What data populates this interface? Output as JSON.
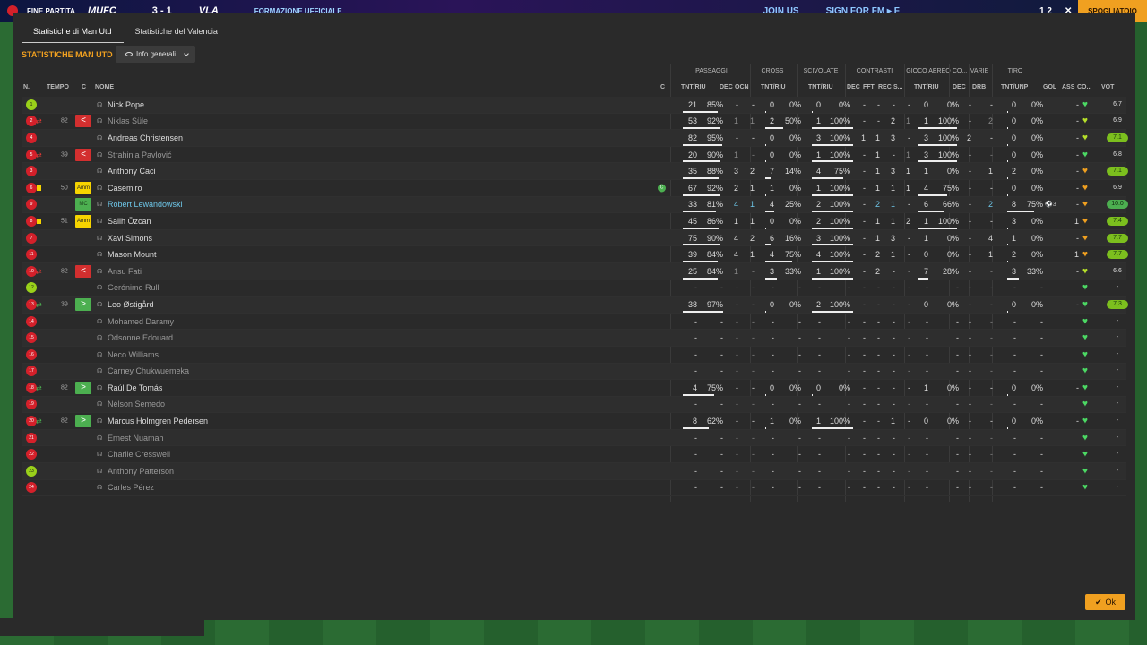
{
  "topbar": {
    "end_label": "FINE PARTITA",
    "home_team": "MUFC",
    "score": "3 - 1",
    "away_team": "VLA",
    "ad1": "FORMAZIONE UFFICIALE",
    "ad2": "JOIN US",
    "ad3": "SIGN FOR FM ▸ F",
    "page": "1 2",
    "close": "✕",
    "scout": "SPOGLIATOIO"
  },
  "tabs": [
    "Statistiche di Man Utd",
    "Statistiche del Valencia"
  ],
  "section_title": "STATISTICHE MAN UTD",
  "dropdown_label": "Info generali",
  "groups": [
    "PASSAGGI",
    "CROSS",
    "SCIVOLATE",
    "CONTRASTI",
    "GIOCO AEREO",
    "CO...",
    "VARIE",
    "TIRO"
  ],
  "headers": {
    "n": "N.",
    "tempo": "TEMPO",
    "c": "C",
    "nome": "NOME",
    "cap": "C",
    "pas_tnt": "TNT/RIU",
    "dec": "DEC",
    "ocn": "OCN",
    "cr_tnt": "TNT/RIU",
    "sc_tnt": "TNT/RIU",
    "ct_dec": "DEC",
    "fft": "FFT",
    "rec": "REC",
    "s": "S...",
    "ga_tnt": "TNT/RIU",
    "co_dec": "DEC",
    "drb": "DRB",
    "tiro": "TNT/UNP",
    "gol": "GOL",
    "ass": "ASS",
    "co": "CO...",
    "vot": "VOT"
  },
  "ok_label": "Ok",
  "players": [
    {
      "n": "1",
      "gk": true,
      "tempo": "",
      "role": "",
      "name": "Nick Pope",
      "style": "",
      "cap": false,
      "pas": [
        "21",
        "85%"
      ],
      "pbar": 0.85,
      "dec": "-",
      "ocn": "-",
      "cr": [
        "0",
        "0%"
      ],
      "crb": 0,
      "sc": [
        "0",
        "0%"
      ],
      "scb": 0,
      "ctdec": "-",
      "fft": "-",
      "rec": "-",
      "s": "-",
      "ga": [
        "0",
        "0%"
      ],
      "gab": 0,
      "codec": "-",
      "drb": "-",
      "tiro": [
        "0",
        "0%"
      ],
      "tb": 0,
      "gol": "",
      "ass": "-",
      "heart": "#4cd964",
      "vot": "6.7",
      "vc": ""
    },
    {
      "n": "2",
      "sub": "out",
      "tempo": "82",
      "role": "<",
      "rc": "off",
      "name": "Niklas Süle",
      "style": "dim",
      "pas": [
        "53",
        "92%"
      ],
      "pbar": 0.92,
      "dec": "1",
      "ocn": "1",
      "cr": [
        "2",
        "50%"
      ],
      "crb": 0.5,
      "sc": [
        "1",
        "100%"
      ],
      "scb": 1,
      "ctdec": "-",
      "fft": "-",
      "rec": "2",
      "s": "1",
      "ga": [
        "1",
        "100%"
      ],
      "gab": 1,
      "codec": "-",
      "drb": "2",
      "tiro": [
        "0",
        "0%"
      ],
      "tb": 0,
      "gol": "",
      "ass": "-",
      "heart": "#b6e02a",
      "vot": "6.9",
      "vc": ""
    },
    {
      "n": "4",
      "tempo": "",
      "role": "",
      "name": "Andreas Christensen",
      "style": "",
      "pas": [
        "82",
        "95%"
      ],
      "pbar": 0.95,
      "dec": "-",
      "ocn": "-",
      "cr": [
        "0",
        "0%"
      ],
      "crb": 0,
      "sc": [
        "3",
        "100%"
      ],
      "scb": 1,
      "ctdec": "1",
      "fft": "1",
      "rec": "3",
      "s": "-",
      "ga": [
        "3",
        "100%"
      ],
      "gab": 1,
      "codec": "2",
      "drb": "-",
      "tiro": [
        "0",
        "0%"
      ],
      "tb": 0,
      "gol": "",
      "ass": "-",
      "heart": "#b6e02a",
      "vot": "7.1",
      "vc": "g"
    },
    {
      "n": "5",
      "sub": "out",
      "tempo": "39",
      "role": "<",
      "rc": "off",
      "name": "Strahinja Pavlović",
      "style": "dim",
      "pas": [
        "20",
        "90%"
      ],
      "pbar": 0.9,
      "dec": "1",
      "ocn": "-",
      "cr": [
        "0",
        "0%"
      ],
      "crb": 0,
      "sc": [
        "1",
        "100%"
      ],
      "scb": 1,
      "ctdec": "-",
      "fft": "1",
      "rec": "-",
      "s": "1",
      "ga": [
        "3",
        "100%"
      ],
      "gab": 1,
      "codec": "-",
      "drb": "-",
      "tiro": [
        "0",
        "0%"
      ],
      "tb": 0,
      "gol": "",
      "ass": "-",
      "heart": "#4cd964",
      "vot": "6.8",
      "vc": ""
    },
    {
      "n": "3",
      "tempo": "",
      "role": "",
      "name": "Anthony Caci",
      "style": "",
      "pas": [
        "35",
        "88%"
      ],
      "pbar": 0.88,
      "dec": "3",
      "ocn": "2",
      "cr": [
        "7",
        "14%"
      ],
      "crb": 0.14,
      "sc": [
        "4",
        "75%"
      ],
      "scb": 0.75,
      "ctdec": "-",
      "fft": "1",
      "rec": "3",
      "s": "1",
      "ga": [
        "1",
        "0%"
      ],
      "gab": 0,
      "codec": "-",
      "drb": "1",
      "tiro": [
        "2",
        "0%"
      ],
      "tb": 0,
      "gol": "",
      "ass": "-",
      "heart": "#f0a020",
      "vot": "7.1",
      "vc": "g"
    },
    {
      "n": "6",
      "yellow": true,
      "tempo": "50",
      "role": "Amm",
      "rc": "amm",
      "name": "Casemiro",
      "style": "",
      "cap": true,
      "pas": [
        "67",
        "92%"
      ],
      "pbar": 0.92,
      "dec": "2",
      "ocn": "1",
      "cr": [
        "1",
        "0%"
      ],
      "crb": 0,
      "sc": [
        "1",
        "100%"
      ],
      "scb": 1,
      "ctdec": "-",
      "fft": "1",
      "rec": "1",
      "s": "1",
      "ga": [
        "4",
        "75%"
      ],
      "gab": 0.75,
      "codec": "-",
      "drb": "-",
      "tiro": [
        "0",
        "0%"
      ],
      "tb": 0,
      "gol": "",
      "ass": "-",
      "heart": "#f0a020",
      "vot": "6.9",
      "vc": ""
    },
    {
      "n": "9",
      "tempo": "",
      "role": "MC",
      "rc": "mc",
      "name": "Robert Lewandowski",
      "style": "link",
      "pas": [
        "33",
        "81%"
      ],
      "pbar": 0.81,
      "dec": "4",
      "ocn": "1",
      "hl": true,
      "cr": [
        "4",
        "25%"
      ],
      "crb": 0.25,
      "sc": [
        "2",
        "100%"
      ],
      "scb": 1,
      "ctdec": "-",
      "fft": "2",
      "rec": "1",
      "s": "-",
      "ga": [
        "6",
        "66%"
      ],
      "gab": 0.66,
      "codec": "-",
      "drb": "2",
      "tiro": [
        "8",
        "75%"
      ],
      "tb": 0.75,
      "gol": "⚽3",
      "ass": "-",
      "heart": "#f0a020",
      "vot": "10.0",
      "vc": "g2"
    },
    {
      "n": "8",
      "yellow": true,
      "tempo": "51",
      "role": "Amm",
      "rc": "amm",
      "name": "Salih Özcan",
      "style": "",
      "pas": [
        "45",
        "86%"
      ],
      "pbar": 0.86,
      "dec": "1",
      "ocn": "1",
      "cr": [
        "0",
        "0%"
      ],
      "crb": 0,
      "sc": [
        "2",
        "100%"
      ],
      "scb": 1,
      "ctdec": "-",
      "fft": "1",
      "rec": "1",
      "s": "2",
      "ga": [
        "1",
        "100%"
      ],
      "gab": 1,
      "codec": "-",
      "drb": "-",
      "tiro": [
        "3",
        "0%"
      ],
      "tb": 0,
      "gol": "",
      "ass": "1",
      "heart": "#f0a020",
      "vot": "7.4",
      "vc": "g"
    },
    {
      "n": "7",
      "tempo": "",
      "role": "",
      "name": "Xavi Simons",
      "style": "",
      "pas": [
        "75",
        "90%"
      ],
      "pbar": 0.9,
      "dec": "4",
      "ocn": "2",
      "cr": [
        "6",
        "16%"
      ],
      "crb": 0.16,
      "sc": [
        "3",
        "100%"
      ],
      "scb": 1,
      "ctdec": "-",
      "fft": "1",
      "rec": "3",
      "s": "-",
      "ga": [
        "1",
        "0%"
      ],
      "gab": 0,
      "codec": "-",
      "drb": "4",
      "tiro": [
        "1",
        "0%"
      ],
      "tb": 0,
      "gol": "",
      "ass": "-",
      "heart": "#f0a020",
      "vot": "7.7",
      "vc": "g"
    },
    {
      "n": "11",
      "tempo": "",
      "role": "",
      "name": "Mason Mount",
      "style": "",
      "pas": [
        "39",
        "84%"
      ],
      "pbar": 0.84,
      "dec": "4",
      "ocn": "1",
      "cr": [
        "4",
        "75%"
      ],
      "crb": 0.75,
      "sc": [
        "4",
        "100%"
      ],
      "scb": 1,
      "ctdec": "-",
      "fft": "2",
      "rec": "1",
      "s": "-",
      "ga": [
        "0",
        "0%"
      ],
      "gab": 0,
      "codec": "-",
      "drb": "1",
      "tiro": [
        "2",
        "0%"
      ],
      "tb": 0,
      "gol": "",
      "ass": "1",
      "heart": "#f0a020",
      "vot": "7.7",
      "vc": "g"
    },
    {
      "n": "10",
      "sub": "out",
      "tempo": "82",
      "role": "<",
      "rc": "off",
      "name": "Ansu Fati",
      "style": "dim",
      "pas": [
        "25",
        "84%"
      ],
      "pbar": 0.84,
      "dec": "1",
      "ocn": "-",
      "cr": [
        "3",
        "33%"
      ],
      "crb": 0.33,
      "sc": [
        "1",
        "100%"
      ],
      "scb": 1,
      "ctdec": "-",
      "fft": "2",
      "rec": "-",
      "s": "-",
      "ga": [
        "7",
        "28%"
      ],
      "gab": 0.28,
      "codec": "-",
      "drb": "-",
      "tiro": [
        "3",
        "33%"
      ],
      "tb": 0.33,
      "gol": "",
      "ass": "-",
      "heart": "#b6e02a",
      "vot": "6.6",
      "vc": ""
    },
    {
      "n": "12",
      "gk": true,
      "tempo": "",
      "role": "",
      "name": "Gerónimo Rulli",
      "style": "dim",
      "pas": [
        "-",
        "-"
      ],
      "dec": "-",
      "ocn": "-",
      "cr": [
        "-",
        "-"
      ],
      "sc": [
        "-",
        "-"
      ],
      "ctdec": "-",
      "fft": "-",
      "rec": "-",
      "s": "-",
      "ga": [
        "-",
        "-"
      ],
      "codec": "-",
      "drb": "-",
      "tiro": [
        "-",
        "-"
      ],
      "gol": "",
      "ass": "",
      "heart": "#4cd964",
      "vot": "-",
      "vc": ""
    },
    {
      "n": "13",
      "sub": "in",
      "tempo": "39",
      "role": ">",
      "rc": "on",
      "name": "Leo Østigård",
      "style": "",
      "pas": [
        "38",
        "97%"
      ],
      "pbar": 0.97,
      "dec": "-",
      "ocn": "-",
      "cr": [
        "0",
        "0%"
      ],
      "crb": 0,
      "sc": [
        "2",
        "100%"
      ],
      "scb": 1,
      "ctdec": "-",
      "fft": "-",
      "rec": "-",
      "s": "-",
      "ga": [
        "0",
        "0%"
      ],
      "gab": 0,
      "codec": "-",
      "drb": "-",
      "tiro": [
        "0",
        "0%"
      ],
      "tb": 0,
      "gol": "",
      "ass": "-",
      "heart": "#4cd964",
      "vot": "7.3",
      "vc": "g"
    },
    {
      "n": "14",
      "tempo": "",
      "role": "",
      "name": "Mohamed Daramy",
      "style": "dim",
      "pas": [
        "-",
        "-"
      ],
      "dec": "-",
      "ocn": "-",
      "cr": [
        "-",
        "-"
      ],
      "sc": [
        "-",
        "-"
      ],
      "ctdec": "-",
      "fft": "-",
      "rec": "-",
      "s": "-",
      "ga": [
        "-",
        "-"
      ],
      "codec": "-",
      "drb": "-",
      "tiro": [
        "-",
        "-"
      ],
      "gol": "",
      "ass": "",
      "heart": "#4cd964",
      "vot": "-",
      "vc": ""
    },
    {
      "n": "15",
      "tempo": "",
      "role": "",
      "name": "Odsonne Edouard",
      "style": "dim",
      "pas": [
        "-",
        "-"
      ],
      "dec": "-",
      "ocn": "-",
      "cr": [
        "-",
        "-"
      ],
      "sc": [
        "-",
        "-"
      ],
      "ctdec": "-",
      "fft": "-",
      "rec": "-",
      "s": "-",
      "ga": [
        "-",
        "-"
      ],
      "codec": "-",
      "drb": "-",
      "tiro": [
        "-",
        "-"
      ],
      "gol": "",
      "ass": "",
      "heart": "#4cd964",
      "vot": "-",
      "vc": ""
    },
    {
      "n": "16",
      "tempo": "",
      "role": "",
      "name": "Neco Williams",
      "style": "dim",
      "pas": [
        "-",
        "-"
      ],
      "dec": "-",
      "ocn": "-",
      "cr": [
        "-",
        "-"
      ],
      "sc": [
        "-",
        "-"
      ],
      "ctdec": "-",
      "fft": "-",
      "rec": "-",
      "s": "-",
      "ga": [
        "-",
        "-"
      ],
      "codec": "-",
      "drb": "-",
      "tiro": [
        "-",
        "-"
      ],
      "gol": "",
      "ass": "",
      "heart": "#4cd964",
      "vot": "-",
      "vc": ""
    },
    {
      "n": "17",
      "tempo": "",
      "role": "",
      "name": "Carney Chukwuemeka",
      "style": "dim",
      "pas": [
        "-",
        "-"
      ],
      "dec": "-",
      "ocn": "-",
      "cr": [
        "-",
        "-"
      ],
      "sc": [
        "-",
        "-"
      ],
      "ctdec": "-",
      "fft": "-",
      "rec": "-",
      "s": "-",
      "ga": [
        "-",
        "-"
      ],
      "codec": "-",
      "drb": "-",
      "tiro": [
        "-",
        "-"
      ],
      "gol": "",
      "ass": "",
      "heart": "#4cd964",
      "vot": "-",
      "vc": ""
    },
    {
      "n": "18",
      "sub": "in",
      "tempo": "82",
      "role": ">",
      "rc": "on",
      "name": "Raúl De Tomás",
      "style": "",
      "pas": [
        "4",
        "75%"
      ],
      "pbar": 0.75,
      "dec": "-",
      "ocn": "-",
      "cr": [
        "0",
        "0%"
      ],
      "crb": 0,
      "sc": [
        "0",
        "0%"
      ],
      "scb": 0,
      "ctdec": "-",
      "fft": "-",
      "rec": "-",
      "s": "-",
      "ga": [
        "1",
        "0%"
      ],
      "gab": 0,
      "codec": "-",
      "drb": "-",
      "tiro": [
        "0",
        "0%"
      ],
      "tb": 0,
      "gol": "",
      "ass": "-",
      "heart": "#4cd964",
      "vot": "-",
      "vc": ""
    },
    {
      "n": "19",
      "tempo": "",
      "role": "",
      "name": "Nélson Semedo",
      "style": "dim",
      "pas": [
        "-",
        "-"
      ],
      "dec": "-",
      "ocn": "-",
      "cr": [
        "-",
        "-"
      ],
      "sc": [
        "-",
        "-"
      ],
      "ctdec": "-",
      "fft": "-",
      "rec": "-",
      "s": "-",
      "ga": [
        "-",
        "-"
      ],
      "codec": "-",
      "drb": "-",
      "tiro": [
        "-",
        "-"
      ],
      "gol": "",
      "ass": "",
      "heart": "#4cd964",
      "vot": "-",
      "vc": ""
    },
    {
      "n": "20",
      "sub": "in",
      "tempo": "82",
      "role": ">",
      "rc": "on",
      "name": "Marcus Holmgren Pedersen",
      "style": "",
      "pas": [
        "8",
        "62%"
      ],
      "pbar": 0.62,
      "dec": "-",
      "ocn": "-",
      "cr": [
        "1",
        "0%"
      ],
      "crb": 0,
      "sc": [
        "1",
        "100%"
      ],
      "scb": 1,
      "ctdec": "-",
      "fft": "-",
      "rec": "1",
      "s": "-",
      "ga": [
        "0",
        "0%"
      ],
      "gab": 0,
      "codec": "-",
      "drb": "-",
      "tiro": [
        "0",
        "0%"
      ],
      "tb": 0,
      "gol": "",
      "ass": "-",
      "heart": "#4cd964",
      "vot": "-",
      "vc": ""
    },
    {
      "n": "21",
      "tempo": "",
      "role": "",
      "name": "Ernest Nuamah",
      "style": "dim",
      "pas": [
        "-",
        "-"
      ],
      "dec": "-",
      "ocn": "-",
      "cr": [
        "-",
        "-"
      ],
      "sc": [
        "-",
        "-"
      ],
      "ctdec": "-",
      "fft": "-",
      "rec": "-",
      "s": "-",
      "ga": [
        "-",
        "-"
      ],
      "codec": "-",
      "drb": "-",
      "tiro": [
        "-",
        "-"
      ],
      "gol": "",
      "ass": "",
      "heart": "#4cd964",
      "vot": "-",
      "vc": ""
    },
    {
      "n": "22",
      "tempo": "",
      "role": "",
      "name": "Charlie Cresswell",
      "style": "dim",
      "pas": [
        "-",
        "-"
      ],
      "dec": "-",
      "ocn": "-",
      "cr": [
        "-",
        "-"
      ],
      "sc": [
        "-",
        "-"
      ],
      "ctdec": "-",
      "fft": "-",
      "rec": "-",
      "s": "-",
      "ga": [
        "-",
        "-"
      ],
      "codec": "-",
      "drb": "-",
      "tiro": [
        "-",
        "-"
      ],
      "gol": "",
      "ass": "",
      "heart": "#4cd964",
      "vot": "-",
      "vc": ""
    },
    {
      "n": "23",
      "gk": true,
      "tempo": "",
      "role": "",
      "name": "Anthony Patterson",
      "style": "dim",
      "pas": [
        "-",
        "-"
      ],
      "dec": "-",
      "ocn": "-",
      "cr": [
        "-",
        "-"
      ],
      "sc": [
        "-",
        "-"
      ],
      "ctdec": "-",
      "fft": "-",
      "rec": "-",
      "s": "-",
      "ga": [
        "-",
        "-"
      ],
      "codec": "-",
      "drb": "-",
      "tiro": [
        "-",
        "-"
      ],
      "gol": "",
      "ass": "",
      "heart": "#4cd964",
      "vot": "-",
      "vc": ""
    },
    {
      "n": "24",
      "tempo": "",
      "role": "",
      "name": "Carles Pérez",
      "style": "dim",
      "pas": [
        "-",
        "-"
      ],
      "dec": "-",
      "ocn": "-",
      "cr": [
        "-",
        "-"
      ],
      "sc": [
        "-",
        "-"
      ],
      "ctdec": "-",
      "fft": "-",
      "rec": "-",
      "s": "-",
      "ga": [
        "-",
        "-"
      ],
      "codec": "-",
      "drb": "-",
      "tiro": [
        "-",
        "-"
      ],
      "gol": "",
      "ass": "",
      "heart": "#4cd964",
      "vot": "-",
      "vc": ""
    }
  ]
}
